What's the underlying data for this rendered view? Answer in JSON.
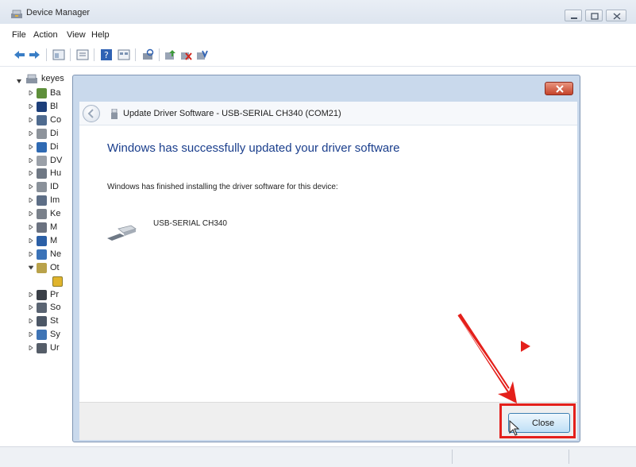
{
  "window": {
    "title": "Device Manager",
    "menu": [
      "File",
      "Action",
      "View",
      "Help"
    ]
  },
  "tree": {
    "root_label": "keyes",
    "items": [
      {
        "label": "Ba",
        "icon": "battery-icon",
        "color": "#5e8f3a"
      },
      {
        "label": "Bl",
        "icon": "bluetooth-icon",
        "color": "#1d3f7a"
      },
      {
        "label": "Co",
        "icon": "computer-icon",
        "color": "#4f6b8f"
      },
      {
        "label": "Di",
        "icon": "disk-drive-icon",
        "color": "#8d939b"
      },
      {
        "label": "Di",
        "icon": "display-adapter-icon",
        "color": "#2f6ab3"
      },
      {
        "label": "DV",
        "icon": "dvd-drive-icon",
        "color": "#9aa0a8"
      },
      {
        "label": "Hu",
        "icon": "human-interface-icon",
        "color": "#6f7884"
      },
      {
        "label": "ID",
        "icon": "ide-controller-icon",
        "color": "#8a919a"
      },
      {
        "label": "Im",
        "icon": "imaging-device-icon",
        "color": "#5d6e86"
      },
      {
        "label": "Ke",
        "icon": "keyboard-icon",
        "color": "#7a818b"
      },
      {
        "label": "M",
        "icon": "mouse-icon",
        "color": "#6b7280"
      },
      {
        "label": "M",
        "icon": "monitor-icon",
        "color": "#2b5fa6"
      },
      {
        "label": "Ne",
        "icon": "network-adapter-icon",
        "color": "#3b73b8"
      },
      {
        "label": "Ot",
        "icon": "other-devices-icon",
        "color": "#b9a24a"
      },
      {
        "label": "",
        "icon": "unknown-device-warning-icon",
        "color": "#e0b42c"
      },
      {
        "label": "Pr",
        "icon": "processor-icon",
        "color": "#3a3f47"
      },
      {
        "label": "So",
        "icon": "sound-icon",
        "color": "#5a6472"
      },
      {
        "label": "St",
        "icon": "storage-controller-icon",
        "color": "#4c5766"
      },
      {
        "label": "Sy",
        "icon": "system-devices-icon",
        "color": "#3f74b5"
      },
      {
        "label": "Ur",
        "icon": "usb-controller-icon",
        "color": "#555d68"
      }
    ]
  },
  "dialog": {
    "title": "Update Driver Software - USB-SERIAL CH340 (COM21)",
    "heading": "Windows has successfully updated your driver software",
    "message": "Windows has finished installing the driver software for this device:",
    "device_name": "USB-SERIAL CH340",
    "close_label": "Close"
  },
  "colors": {
    "heading_blue": "#1a3e8c",
    "annotation_red": "#e4201b",
    "dialog_frame": "#c9d9ec"
  }
}
